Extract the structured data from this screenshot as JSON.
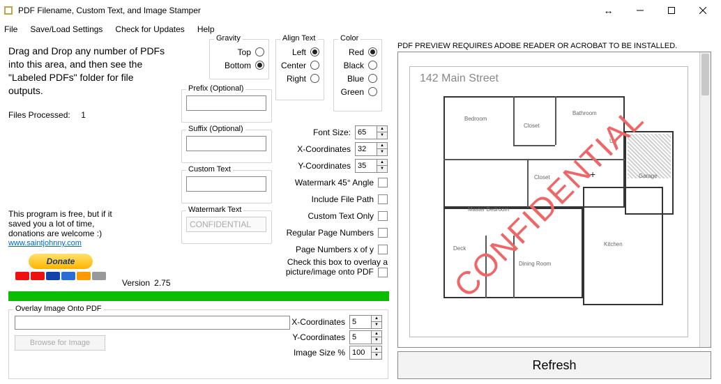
{
  "window": {
    "title": "PDF Filename, Custom Text, and Image Stamper"
  },
  "menu": {
    "file": "File",
    "saveload": "Save/Load Settings",
    "updates": "Check for Updates",
    "help": "Help"
  },
  "instructions": "Drag and Drop any number of PDFs into this area, and then see the \"Labeled PDFs\" folder for file outputs.",
  "processed_label": "Files Processed:",
  "processed_count": "1",
  "donate": {
    "line1": "This program is free, but if it saved you a lot of time, donations are welcome :)",
    "link": "www.saintjohnny.com",
    "button": "Donate"
  },
  "version_prefix": "Version",
  "version": "2.75",
  "groups": {
    "prefix": "Prefix (Optional)",
    "suffix": "Suffix (Optional)",
    "custom": "Custom Text",
    "watermark": "Watermark Text",
    "watermark_value": "CONFIDENTIAL",
    "gravity": "Gravity",
    "align": "Align Text",
    "color": "Color",
    "overlay": "Overlay Image Onto PDF"
  },
  "gravity": {
    "top": "Top",
    "bottom": "Bottom",
    "selected": "bottom"
  },
  "align": {
    "left": "Left",
    "center": "Center",
    "right": "Right",
    "selected": "left"
  },
  "color": {
    "red": "Red",
    "black": "Black",
    "blue": "Blue",
    "green": "Green",
    "selected": "red"
  },
  "controls": {
    "font_size": {
      "label": "Font Size:",
      "value": "65"
    },
    "x": {
      "label": "X-Coordinates",
      "value": "32"
    },
    "y": {
      "label": "Y-Coordinates",
      "value": "35"
    },
    "angle": {
      "label": "Watermark 45° Angle"
    },
    "filepath": {
      "label": "Include File Path"
    },
    "custom_only": {
      "label": "Custom Text Only"
    },
    "regular_pn": {
      "label": "Regular Page Numbers"
    },
    "pn_xofy": {
      "label": "Page Numbers x of y"
    }
  },
  "overlay_note": "Check this box to overlay a picture/image onto PDF",
  "overlay": {
    "browse": "Browse for Image",
    "x": {
      "label": "X-Coordinates",
      "value": "5"
    },
    "y": {
      "label": "Y-Coordinates",
      "value": "5"
    },
    "size": {
      "label": "Image Size %",
      "value": "100"
    }
  },
  "preview": {
    "msg": "PDF PREVIEW REQUIRES ADOBE READER OR ACROBAT TO BE INSTALLED.",
    "address": "142 Main Street",
    "stamp": "CONFIDENTIAL",
    "rooms": {
      "bedroom": "Bedroom",
      "bathroom": "Bathroom",
      "closet": "Closet",
      "closet2": "Closet",
      "master": "Master Bedroom",
      "garage": "Garage",
      "up": "Up",
      "deck": "Deck",
      "dining": "Dining Room",
      "kitchen": "Kitchen"
    }
  },
  "refresh": "Refresh"
}
